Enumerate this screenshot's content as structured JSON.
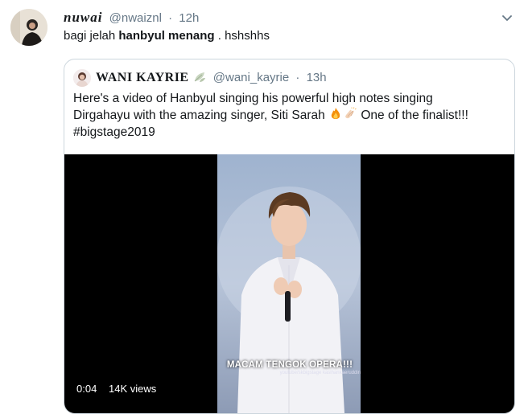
{
  "tweet": {
    "display_name": "nuwai",
    "handle": "@nwaiznl",
    "separator": "·",
    "time": "12h",
    "text_before": "bagi jelah ",
    "text_bold": "hanbyul menang",
    "text_after": " . hshshhs"
  },
  "quoted": {
    "display_name": "WANI KAYRIE",
    "handle": "@wani_kayrie",
    "separator": "·",
    "time": "13h",
    "text_line1": "Here's a video of Hanbyul singing his powerful high notes singing",
    "text_line2_before": "Dirgahayu with the amazing singer, Siti Sarah ",
    "text_line2_after": " One of the finalist!!!",
    "text_line3": "#bigstage2019",
    "video": {
      "overlay_caption": "MACAM TENGOK OPERA!!!",
      "overlay_credit": "youtube/skbigstage kasihankaeruddin",
      "duration": "0:04",
      "views": "14K views"
    }
  },
  "icons": {
    "more": "chevron-down-icon",
    "leaf": "leaf-icon",
    "fire": "fire-emoji",
    "clap": "clapping-hands-emoji"
  },
  "colors": {
    "text": "#14171a",
    "secondary": "#657786",
    "border": "#ccd6dd",
    "video_bg": "#000000"
  }
}
